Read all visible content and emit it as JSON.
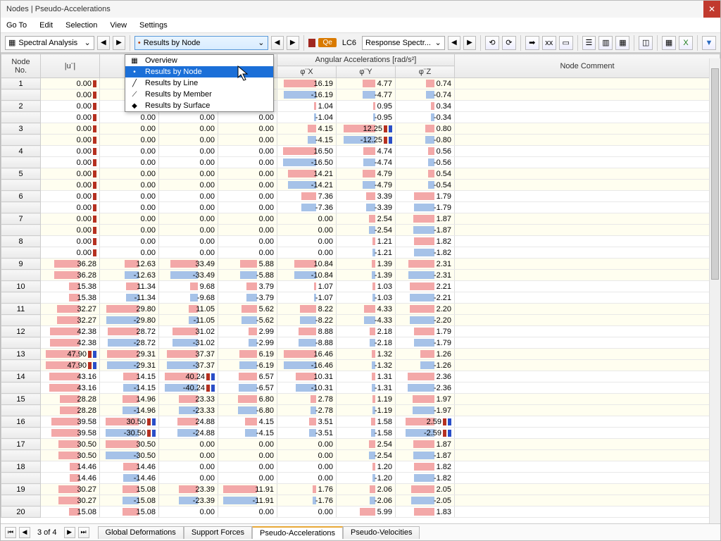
{
  "window": {
    "title": "Nodes | Pseudo-Accelerations"
  },
  "menubar": [
    "Go To",
    "Edit",
    "Selection",
    "View",
    "Settings"
  ],
  "toolbar": {
    "analysis_combo": "Spectral Analysis",
    "results_combo": "Results by Node",
    "lc_label": "LC6",
    "qe_label": "Qe",
    "method_combo": "Response Spectr..."
  },
  "dropdown": {
    "items": [
      {
        "label": "Overview",
        "icon": "▦"
      },
      {
        "label": "Results by Node",
        "icon": "•",
        "selected": true
      },
      {
        "label": "Results by Line",
        "icon": "╱"
      },
      {
        "label": "Results by Member",
        "icon": "⟋"
      },
      {
        "label": "Results by Surface",
        "icon": "◆"
      }
    ]
  },
  "headers": {
    "node": "Node\nNo.",
    "u": "|u¨|",
    "accel_group": "Angular Accelerations [rad/s²]",
    "phix": "φ¨X",
    "phiy": "φ¨Y",
    "phiz": "φ¨Z",
    "comment": "Node Comment"
  },
  "max_abs": {
    "u": 48,
    "c2": 31,
    "c3": 41,
    "c4": 12,
    "phix": 17,
    "phiy": 13,
    "phiz": 3
  },
  "rows": [
    {
      "node": 1,
      "band": "a",
      "r": [
        {
          "u": 0.0,
          "c2": null,
          "c3": null,
          "c4": null,
          "phix": 16.19,
          "phiy": 4.77,
          "phiz": 0.74,
          "mk": "r"
        },
        {
          "u": 0.0,
          "c2": null,
          "c3": null,
          "c4": null,
          "phix": -16.19,
          "phiy": -4.77,
          "phiz": -0.74,
          "mk": "r"
        }
      ]
    },
    {
      "node": 2,
      "band": "b",
      "r": [
        {
          "u": 0.0,
          "c2": 0.0,
          "c3": 0.0,
          "c4": 0.0,
          "phix": 1.04,
          "phiy": 0.95,
          "phiz": 0.34,
          "mk": "r"
        },
        {
          "u": 0.0,
          "c2": 0.0,
          "c3": 0.0,
          "c4": 0.0,
          "phix": -1.04,
          "phiy": -0.95,
          "phiz": -0.34,
          "mk": "r"
        }
      ]
    },
    {
      "node": 3,
      "band": "a",
      "r": [
        {
          "u": 0.0,
          "c2": 0.0,
          "c3": 0.0,
          "c4": 0.0,
          "phix": 4.15,
          "phiy": 12.25,
          "phiz": 0.8,
          "mk": "r",
          "mky": "rb"
        },
        {
          "u": 0.0,
          "c2": 0.0,
          "c3": 0.0,
          "c4": 0.0,
          "phix": -4.15,
          "phiy": -12.25,
          "phiz": -0.8,
          "mk": "r",
          "mky": "rb"
        }
      ]
    },
    {
      "node": 4,
      "band": "b",
      "r": [
        {
          "u": 0.0,
          "c2": 0.0,
          "c3": 0.0,
          "c4": 0.0,
          "phix": 16.5,
          "phiy": 4.74,
          "phiz": 0.56,
          "mk": "r"
        },
        {
          "u": 0.0,
          "c2": 0.0,
          "c3": 0.0,
          "c4": 0.0,
          "phix": -16.5,
          "phiy": -4.74,
          "phiz": -0.56,
          "mk": "r"
        }
      ]
    },
    {
      "node": 5,
      "band": "a",
      "r": [
        {
          "u": 0.0,
          "c2": 0.0,
          "c3": 0.0,
          "c4": 0.0,
          "phix": 14.21,
          "phiy": 4.79,
          "phiz": 0.54,
          "mk": "r"
        },
        {
          "u": 0.0,
          "c2": 0.0,
          "c3": 0.0,
          "c4": 0.0,
          "phix": -14.21,
          "phiy": -4.79,
          "phiz": -0.54,
          "mk": "r"
        }
      ]
    },
    {
      "node": 6,
      "band": "b",
      "r": [
        {
          "u": 0.0,
          "c2": 0.0,
          "c3": 0.0,
          "c4": 0.0,
          "phix": 7.36,
          "phiy": 3.39,
          "phiz": 1.79,
          "mk": "r"
        },
        {
          "u": 0.0,
          "c2": 0.0,
          "c3": 0.0,
          "c4": 0.0,
          "phix": -7.36,
          "phiy": -3.39,
          "phiz": -1.79,
          "mk": "r"
        }
      ]
    },
    {
      "node": 7,
      "band": "a",
      "r": [
        {
          "u": 0.0,
          "c2": 0.0,
          "c3": 0.0,
          "c4": 0.0,
          "phix": 0.0,
          "phiy": 2.54,
          "phiz": 1.87,
          "mk": "r"
        },
        {
          "u": 0.0,
          "c2": 0.0,
          "c3": 0.0,
          "c4": 0.0,
          "phix": 0.0,
          "phiy": -2.54,
          "phiz": -1.87,
          "mk": "r"
        }
      ]
    },
    {
      "node": 8,
      "band": "b",
      "r": [
        {
          "u": 0.0,
          "c2": 0.0,
          "c3": 0.0,
          "c4": 0.0,
          "phix": 0.0,
          "phiy": 1.21,
          "phiz": 1.82,
          "mk": "r"
        },
        {
          "u": 0.0,
          "c2": 0.0,
          "c3": 0.0,
          "c4": 0.0,
          "phix": 0.0,
          "phiy": -1.21,
          "phiz": -1.82,
          "mk": "r"
        }
      ]
    },
    {
      "node": 9,
      "band": "a",
      "r": [
        {
          "u": 36.28,
          "c2": 12.63,
          "c3": 33.49,
          "c4": 5.88,
          "phix": 10.84,
          "phiy": 1.39,
          "phiz": 2.31
        },
        {
          "u": 36.28,
          "c2": -12.63,
          "c3": -33.49,
          "c4": -5.88,
          "phix": -10.84,
          "phiy": -1.39,
          "phiz": -2.31
        }
      ]
    },
    {
      "node": 10,
      "band": "b",
      "r": [
        {
          "u": 15.38,
          "c2": 11.34,
          "c3": 9.68,
          "c4": 3.79,
          "phix": 1.07,
          "phiy": 1.03,
          "phiz": 2.21
        },
        {
          "u": 15.38,
          "c2": -11.34,
          "c3": -9.68,
          "c4": -3.79,
          "phix": -1.07,
          "phiy": -1.03,
          "phiz": -2.21
        }
      ]
    },
    {
      "node": 11,
      "band": "a",
      "r": [
        {
          "u": 32.27,
          "c2": 29.8,
          "c3": 11.05,
          "c4": 5.62,
          "phix": 8.22,
          "phiy": 4.33,
          "phiz": 2.2
        },
        {
          "u": 32.27,
          "c2": -29.8,
          "c3": -11.05,
          "c4": -5.62,
          "phix": -8.22,
          "phiy": -4.33,
          "phiz": -2.2
        }
      ]
    },
    {
      "node": 12,
      "band": "b",
      "r": [
        {
          "u": 42.38,
          "c2": 28.72,
          "c3": 31.02,
          "c4": 2.99,
          "phix": 8.88,
          "phiy": 2.18,
          "phiz": 1.79
        },
        {
          "u": 42.38,
          "c2": -28.72,
          "c3": -31.02,
          "c4": -2.99,
          "phix": -8.88,
          "phiy": -2.18,
          "phiz": -1.79
        }
      ]
    },
    {
      "node": 13,
      "band": "a",
      "r": [
        {
          "u": 47.9,
          "c2": 29.31,
          "c3": 37.37,
          "c4": 6.19,
          "phix": 16.46,
          "phiy": 1.32,
          "phiz": 1.26,
          "mk": "rb"
        },
        {
          "u": 47.9,
          "c2": -29.31,
          "c3": -37.37,
          "c4": -6.19,
          "phix": -16.46,
          "phiy": -1.32,
          "phiz": -1.26,
          "mk": "rb"
        }
      ]
    },
    {
      "node": 14,
      "band": "b",
      "r": [
        {
          "u": 43.16,
          "c2": 14.15,
          "c3": 40.24,
          "c4": 6.57,
          "phix": 10.31,
          "phiy": 1.31,
          "phiz": 2.36,
          "mk3": "rb"
        },
        {
          "u": 43.16,
          "c2": -14.15,
          "c3": -40.24,
          "c4": -6.57,
          "phix": -10.31,
          "phiy": -1.31,
          "phiz": -2.36,
          "mk3": "rb"
        }
      ]
    },
    {
      "node": 15,
      "band": "a",
      "r": [
        {
          "u": 28.28,
          "c2": 14.96,
          "c3": 23.33,
          "c4": 6.8,
          "phix": 2.78,
          "phiy": 1.19,
          "phiz": 1.97
        },
        {
          "u": 28.28,
          "c2": -14.96,
          "c3": -23.33,
          "c4": -6.8,
          "phix": -2.78,
          "phiy": -1.19,
          "phiz": -1.97
        }
      ]
    },
    {
      "node": 16,
      "band": "b",
      "r": [
        {
          "u": 39.58,
          "c2": 30.5,
          "c3": 24.88,
          "c4": 4.15,
          "phix": 3.51,
          "phiy": 1.58,
          "phiz": 2.59,
          "mk2": "rb",
          "mkz": "rb"
        },
        {
          "u": 39.58,
          "c2": -30.5,
          "c3": -24.88,
          "c4": -4.15,
          "phix": -3.51,
          "phiy": -1.58,
          "phiz": -2.59,
          "mk2": "rb",
          "mkz": "rb"
        }
      ]
    },
    {
      "node": 17,
      "band": "a",
      "r": [
        {
          "u": 30.5,
          "c2": 30.5,
          "c3": 0.0,
          "c4": 0.0,
          "phix": 0.0,
          "phiy": 2.54,
          "phiz": 1.87
        },
        {
          "u": 30.5,
          "c2": -30.5,
          "c3": 0.0,
          "c4": 0.0,
          "phix": 0.0,
          "phiy": -2.54,
          "phiz": -1.87
        }
      ]
    },
    {
      "node": 18,
      "band": "b",
      "r": [
        {
          "u": 14.46,
          "c2": 14.46,
          "c3": 0.0,
          "c4": 0.0,
          "phix": 0.0,
          "phiy": 1.2,
          "phiz": 1.82
        },
        {
          "u": 14.46,
          "c2": -14.46,
          "c3": 0.0,
          "c4": 0.0,
          "phix": 0.0,
          "phiy": -1.2,
          "phiz": -1.82
        }
      ]
    },
    {
      "node": 19,
      "band": "a",
      "r": [
        {
          "u": 30.27,
          "c2": 15.08,
          "c3": 23.39,
          "c4": 11.91,
          "phix": 1.76,
          "phiy": 2.06,
          "phiz": 2.05
        },
        {
          "u": 30.27,
          "c2": -15.08,
          "c3": -23.39,
          "c4": -11.91,
          "phix": -1.76,
          "phiy": -2.06,
          "phiz": -2.05
        }
      ]
    },
    {
      "node": 20,
      "band": "b",
      "r": [
        {
          "u": 15.08,
          "c2": 15.08,
          "c3": 0.0,
          "c4": 0.0,
          "phix": 0.0,
          "phiy": 5.99,
          "phiz": 1.83
        }
      ]
    }
  ],
  "status": {
    "page": "3 of 4",
    "tabs": [
      "Global Deformations",
      "Support Forces",
      "Pseudo-Accelerations",
      "Pseudo-Velocities"
    ],
    "active_tab": 2
  }
}
